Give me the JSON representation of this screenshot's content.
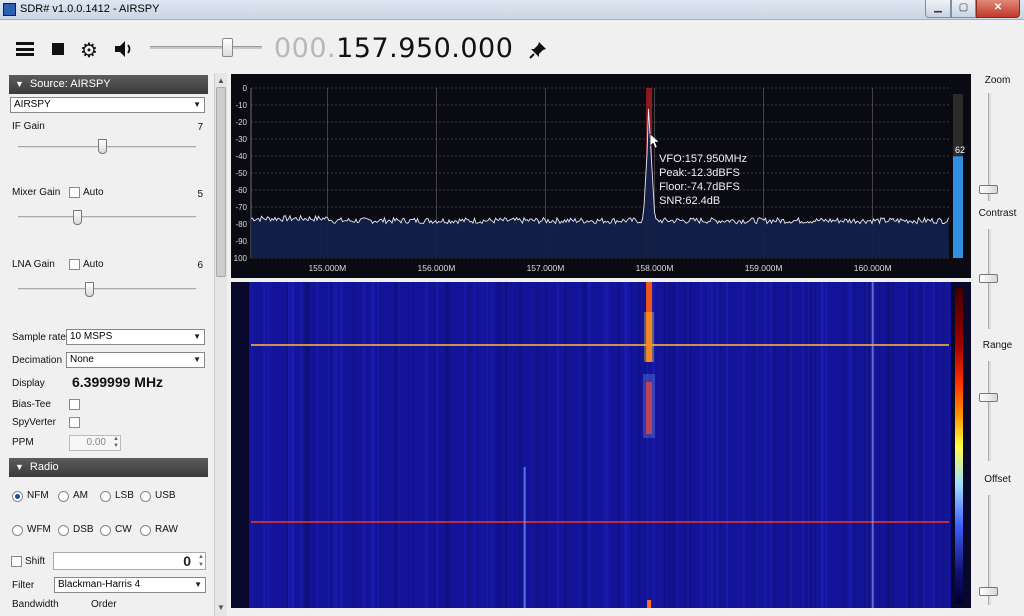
{
  "window": {
    "title": "SDR# v1.0.0.1412 - AIRSPY",
    "min_glyph": "▁",
    "max_glyph": "▢",
    "close_glyph": "✕"
  },
  "toolbar": {
    "freq_dim": "000.",
    "freq_bright": "157.950.000"
  },
  "source": {
    "header": "Source: AIRSPY",
    "device": "AIRSPY",
    "if_gain_label": "IF Gain",
    "if_gain_value": "7",
    "if_gain_level": 0.47,
    "mixer_gain_label": "Mixer Gain",
    "mixer_auto_label": "Auto",
    "mixer_gain_value": "5",
    "mixer_gain_level": 0.33,
    "lna_gain_label": "LNA Gain",
    "lna_auto_label": "Auto",
    "lna_gain_value": "6",
    "lna_gain_level": 0.4,
    "sample_rate_label": "Sample rate",
    "sample_rate_value": "10 MSPS",
    "decimation_label": "Decimation",
    "decimation_value": "None",
    "display_label": "Display",
    "display_value": "6.399999 MHz",
    "bias_tee_label": "Bias-Tee",
    "spyverter_label": "SpyVerter",
    "ppm_label": "PPM",
    "ppm_value": "0.00"
  },
  "radio": {
    "header": "Radio",
    "modes": [
      "NFM",
      "AM",
      "LSB",
      "USB",
      "WFM",
      "DSB",
      "CW",
      "RAW"
    ],
    "selected_mode": "NFM",
    "shift_label": "Shift",
    "shift_value": "0",
    "filter_label": "Filter",
    "filter_value": "Blackman-Harris 4",
    "bandwidth_label": "Bandwidth",
    "order_label": "Order"
  },
  "right_panel": {
    "zoom_label": "Zoom",
    "contrast_label": "Contrast",
    "range_label": "Range",
    "offset_label": "Offset"
  },
  "spectrum": {
    "y_ticks": [
      "0",
      "-10",
      "-20",
      "-30",
      "-40",
      "-50",
      "-60",
      "-70",
      "-80",
      "-90",
      "100"
    ],
    "x_ticks": [
      "155.000M",
      "156.000M",
      "157.000M",
      "158.000M",
      "159.000M",
      "160.000M"
    ],
    "x_tick_mhz": [
      155,
      156,
      157,
      158,
      159,
      160
    ],
    "start_mhz": 154.3,
    "end_mhz": 160.7,
    "y_min_db": -100,
    "y_max_db": 0,
    "vfo_mhz": 157.95,
    "floor_db": -78,
    "peak_db": -12.3,
    "spur_mhz": 160.0,
    "spur_db": -68,
    "info": {
      "vfo": "VFO:157.950MHz",
      "peak": "Peak:-12.3dBFS",
      "floor": "Floor:-74.7dBFS",
      "snr": "SNR:62.4dB"
    },
    "snr_bar_label": "62",
    "snr_bar_level": 0.62,
    "colors": {
      "trace": "#e8e8f0",
      "fill": "#12204a",
      "grid": "#6a6a6a",
      "vfo_band": "#a12020",
      "snr_bar": "#2f8fe0"
    }
  }
}
